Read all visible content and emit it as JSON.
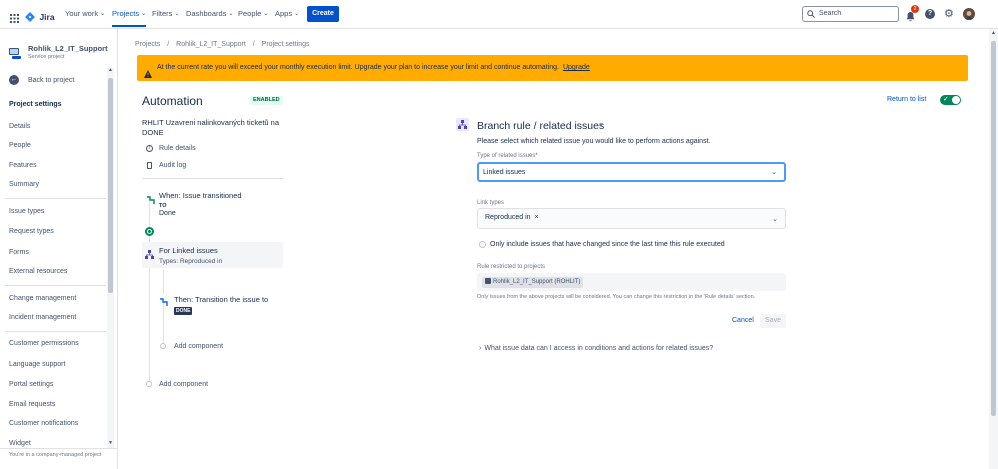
{
  "topnav": {
    "logo_text": "Jira",
    "items": [
      "Your work",
      "Projects",
      "Filters",
      "Dashboards",
      "People",
      "Apps"
    ],
    "create_label": "Create",
    "search_placeholder": "Search",
    "notification_count": "2"
  },
  "sidebar": {
    "project_name": "Rohlik_L2_IT_Support",
    "project_type": "Service project",
    "back_label": "Back to project",
    "section_title": "Project settings",
    "items": [
      "Details",
      "People",
      "Features",
      "Summary",
      "Issue types",
      "Request types",
      "Forms",
      "External resources",
      "Change management",
      "Incident management",
      "Customer permissions",
      "Language support",
      "Portal settings",
      "Email requests",
      "Customer notifications",
      "Widget"
    ],
    "footer": "You're in a company-managed project"
  },
  "breadcrumb": [
    "Projects",
    "Rohlik_L2_IT_Support",
    "Project settings"
  ],
  "banner": {
    "text": "At the current rate you will exceed your monthly execution limit. Upgrade your plan to increase your limit and continue automating.",
    "link": "Upgrade"
  },
  "automation": {
    "title": "Automation",
    "status_badge": "ENABLED",
    "return_link": "Return to list",
    "rule_name": "RHLIT Uzavreni nalinkovaných ticketů na DONE",
    "rule_details": "Rule details",
    "audit_log": "Audit log",
    "when_title": "When: Issue transitioned",
    "when_to": "TO",
    "when_value": "Done",
    "branch_title": "For Linked issues",
    "branch_sub": "Types: Reproduced in",
    "then_title": "Then: Transition the issue to",
    "then_badge": "DONE",
    "add_component_inner": "Add component",
    "add_component_outer": "Add component"
  },
  "panel": {
    "title": "Branch rule / related issues",
    "description": "Please select which related issue you would like to perform actions against.",
    "type_label": "Type of related issues",
    "type_required": "*",
    "type_value": "Linked issues",
    "link_types_label": "Link types",
    "link_types_value": "Reproduced in",
    "checkbox_label": "Only include issues that have changed since the last time this rule executed",
    "restricted_label": "Rule restricted to projects",
    "restricted_value": "Rohlik_L2_IT_Support (ROHLIT)",
    "restricted_hint": "Only issues from the above projects will be considered. You can change this restriction in the 'Rule details' section.",
    "cancel_label": "Cancel",
    "save_label": "Save",
    "faq": "What issue data can I access in conditions and actions for related issues?"
  },
  "colors": {
    "brand": "#0052cc",
    "banner": "#ffab00",
    "toggle": "#00875a",
    "badge_bg": "#e3fcef",
    "badge_text": "#006644"
  }
}
